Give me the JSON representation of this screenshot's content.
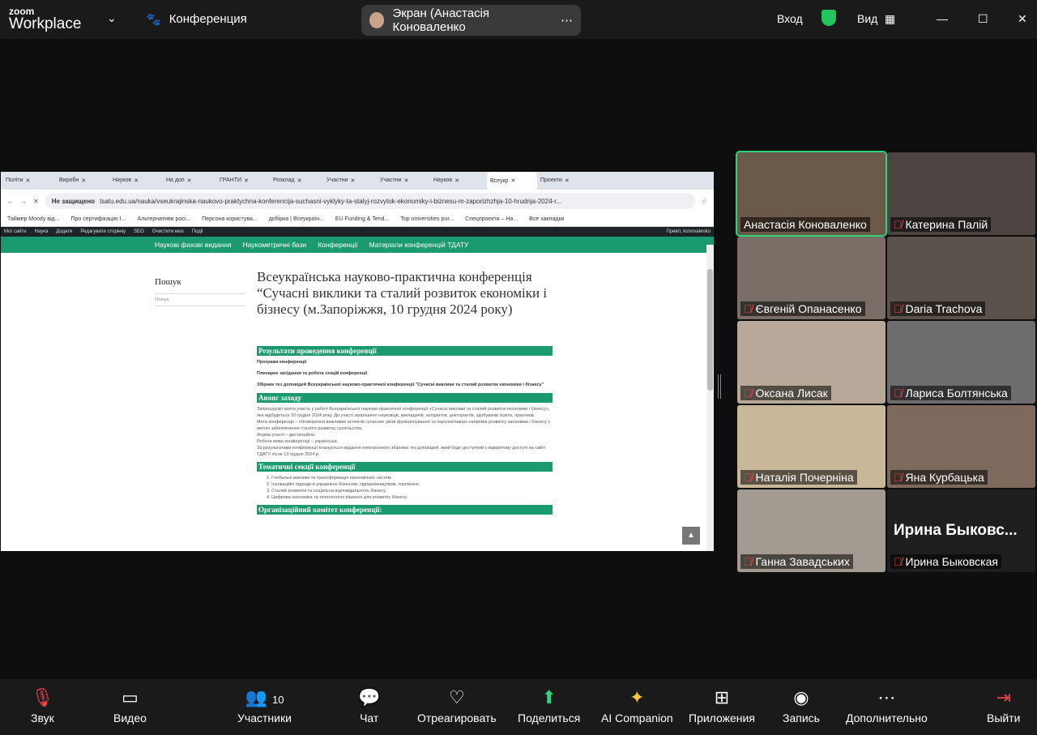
{
  "app": {
    "logo_top": "zoom",
    "logo_bottom": "Workplace",
    "meeting": "Конференция",
    "sharing": "Экран (Анастасія Коноваленко",
    "signin": "Вход",
    "view": "Вид"
  },
  "browser": {
    "tabs": [
      "Політи",
      "Виробн",
      "Науков",
      "На доп",
      "ГРАНТИ",
      "Розклад",
      "Участни",
      "Участни",
      "Науков",
      "Всеукр",
      "Проекти"
    ],
    "insecure": "Не защищено",
    "url": "tsatu.edu.ua/nauka/vseukrajinska-naukovo-praktychna-konferencija-suchasni-vyklyky-ta-stalyj-rozvytok-ekonomiky-i-biznesu-m-zaporizhzhja-10-hrudnja-2024-r...",
    "bookmarks": [
      "Таймер Moody від...",
      "Про сертифікацію І...",
      "Альтернативи росі...",
      "Персона користува...",
      "добірка | Всеукраїн...",
      "EU Funding & Tend...",
      "Top universities pur...",
      "Спецпроекти – На...",
      "Все закладки"
    ],
    "wpbar": [
      "Мої сайти",
      "Наука",
      "Додати",
      "Редагувати сторінку",
      "SEO",
      "Очистити кеш",
      "Події"
    ],
    "wp_greeting": "Привіт, konovalenko",
    "nav": [
      "Наукові фахові видання",
      "Наукометричні бази",
      "Конференції",
      "Матеріали конференцій ТДАТУ"
    ],
    "search_title": "Пошук",
    "search_placeholder": "Пошук",
    "title": "Всеукраїнська науково-практична конференція “Сучасні виклики та сталий розвиток економіки і бізнесу (м.Запоріжжя, 10 грудня 2024 року)",
    "h_results": "Результати проведення конференції",
    "results": [
      "Програма конференції",
      "Пленарне засідання та робота секцій конференції",
      "Збірник тез доповідей Всеукраїнської науково-практичної конференції \"Сучасні виклики та сталий розвиток економіки і бізнесу\""
    ],
    "h_announce": "Анонс заходу",
    "announce": [
      "Запрошуємо взяти участь у роботі Всеукраїнської науково-практичної конференції «Сучасні виклики та сталий розвиток економіки і бізнесу», яка відбудеться 10 грудня 2024 року. До участі запрошено науковців, викладачів, аспірантів, докторантів, здобувачів освіти, практиків.",
      "Мета конференції – обговорення важливих аспектів сучасних умов функціонування та перспективних напрямів розвитку економіки і бізнесу з метою забезпечення сталого розвитку суспільства.",
      "Форма участі – дистанційна.",
      "Робоча мова конференції – українська.",
      "За результатами конференції планується видання електронного збірника тез доповідей, який буде доступний у відкритому доступі на сайті ТДАТУ після 13 грудня 2024 р."
    ],
    "h_sections": "Тематичні секції конференції",
    "sections": [
      "1. Глобальні виклики та трансформація економічних систем.",
      "2. Інноваційні підходи в управлінні бізнесом, підприємництвом, торгівлею.",
      "3. Сталий розвиток та соціальна відповідальність бізнесу.",
      "4. Цифрова економіка та технологічні рішення для розвитку бізнесу."
    ],
    "h_committee": "Організаційний комітет конференції:"
  },
  "participants": [
    "Анастасія Коноваленко",
    "Катерина Палій",
    "Євгеній Опанасенко",
    "Daria Trachova",
    "Оксана Лисак",
    "Лариса Болтянська",
    "Наталія Почерніна",
    "Яна Курбацька",
    "Ганна Завадських",
    "Ирина Быковская"
  ],
  "video_off_name": "Ирина Быковс...",
  "toolbar": {
    "audio": "Звук",
    "video": "Видео",
    "participants": "Участники",
    "participants_count": "10",
    "chat": "Чат",
    "react": "Отреагировать",
    "share": "Поделиться",
    "ai": "AI Companion",
    "apps": "Приложения",
    "record": "Запись",
    "more": "Дополнительно",
    "leave": "Выйти"
  }
}
